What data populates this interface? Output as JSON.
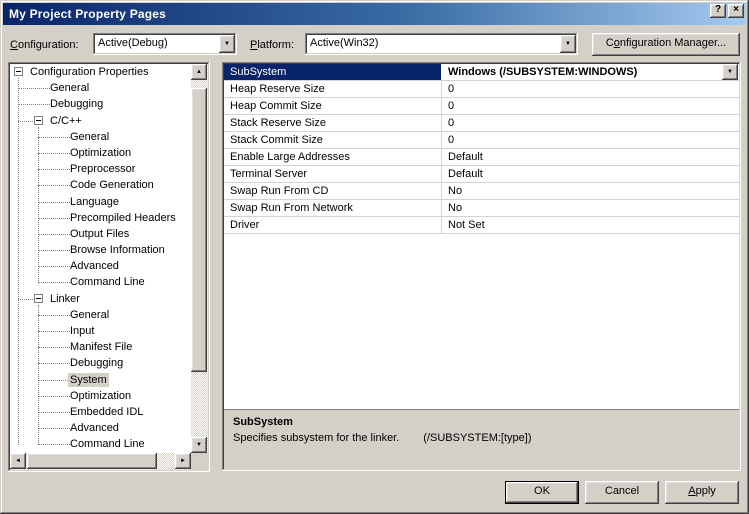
{
  "window": {
    "title": "My Project Property Pages"
  },
  "icons": {
    "help": "?",
    "close": "×",
    "dropdown": "▼",
    "scroll_up": "▲",
    "scroll_down": "▼",
    "scroll_left": "◄",
    "scroll_right": "►"
  },
  "colors": {
    "titlebar_left": "#0a246a",
    "titlebar_right": "#a6caf0",
    "selection": "#0a246a",
    "dialog_bg": "#d4d0c8"
  },
  "toolbar": {
    "configuration_label": {
      "key": "C",
      "rest": "onfiguration:"
    },
    "configuration_value": "Active(Debug)",
    "platform_label": {
      "key": "P",
      "rest": "latform:"
    },
    "platform_value": "Active(Win32)",
    "config_manager": {
      "pre": "C",
      "key": "o",
      "rest": "nfiguration Manager..."
    }
  },
  "tree": {
    "items": [
      {
        "label": "Configuration Properties",
        "level": 0,
        "expander": "minus",
        "selected": false
      },
      {
        "label": "General",
        "level": 1
      },
      {
        "label": "Debugging",
        "level": 1
      },
      {
        "label": "C/C++",
        "level": 1,
        "expander": "minus"
      },
      {
        "label": "General",
        "level": 2
      },
      {
        "label": "Optimization",
        "level": 2
      },
      {
        "label": "Preprocessor",
        "level": 2
      },
      {
        "label": "Code Generation",
        "level": 2
      },
      {
        "label": "Language",
        "level": 2
      },
      {
        "label": "Precompiled Headers",
        "level": 2
      },
      {
        "label": "Output Files",
        "level": 2
      },
      {
        "label": "Browse Information",
        "level": 2
      },
      {
        "label": "Advanced",
        "level": 2
      },
      {
        "label": "Command Line",
        "level": 2
      },
      {
        "label": "Linker",
        "level": 1,
        "expander": "minus"
      },
      {
        "label": "General",
        "level": 2
      },
      {
        "label": "Input",
        "level": 2
      },
      {
        "label": "Manifest File",
        "level": 2
      },
      {
        "label": "Debugging",
        "level": 2
      },
      {
        "label": "System",
        "level": 2,
        "selected": true
      },
      {
        "label": "Optimization",
        "level": 2
      },
      {
        "label": "Embedded IDL",
        "level": 2
      },
      {
        "label": "Advanced",
        "level": 2
      },
      {
        "label": "Command Line",
        "level": 2
      }
    ]
  },
  "grid": {
    "rows": [
      {
        "name": "SubSystem",
        "value": "Windows (/SUBSYSTEM:WINDOWS)",
        "selected": true,
        "has_dropdown": true
      },
      {
        "name": "Heap Reserve Size",
        "value": "0"
      },
      {
        "name": "Heap Commit Size",
        "value": "0"
      },
      {
        "name": "Stack Reserve Size",
        "value": "0"
      },
      {
        "name": "Stack Commit Size",
        "value": "0"
      },
      {
        "name": "Enable Large Addresses",
        "value": "Default"
      },
      {
        "name": "Terminal Server",
        "value": "Default"
      },
      {
        "name": "Swap Run From CD",
        "value": "No"
      },
      {
        "name": "Swap Run From Network",
        "value": "No"
      },
      {
        "name": "Driver",
        "value": "Not Set"
      }
    ]
  },
  "description": {
    "title": "SubSystem",
    "text": "Specifies subsystem for the linker.",
    "flag": "(/SUBSYSTEM:[type])"
  },
  "buttons": {
    "ok": "OK",
    "cancel": "Cancel",
    "apply": {
      "key": "A",
      "rest": "pply"
    }
  }
}
